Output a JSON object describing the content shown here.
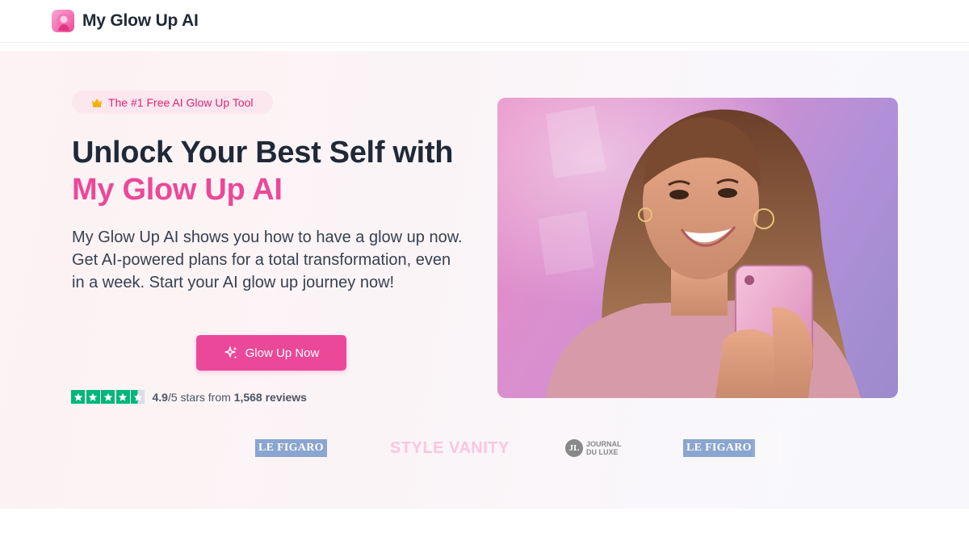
{
  "nav": {
    "brand": "My Glow Up AI",
    "logo_icon": "woman-silhouette-icon"
  },
  "hero": {
    "badge": {
      "icon": "crown-icon",
      "label": "The #1 Free AI Glow Up Tool"
    },
    "headline_line1": "Unlock Your Best Self with",
    "headline_accent": "My Glow Up AI",
    "lead": "My Glow Up AI shows you how to have a glow up now. Get AI-powered plans for a total transformation, even in a week. Start your AI glow up journey now!",
    "cta": {
      "label": "Glow Up Now",
      "icon": "sparkles-icon"
    },
    "rating": {
      "score": "4.9",
      "out_of": "/5 stars from ",
      "reviews": "1,568 reviews",
      "stars": 4.5
    },
    "image_icon": "woman-with-phone-photo"
  },
  "press": {
    "logos": [
      "LE FIGARO",
      "STYLE VANITY",
      "JOURNAL DU LUXE",
      "LE FIGARO"
    ]
  },
  "colors": {
    "accent": "#ec4899",
    "accent_soft": "#fce7ef",
    "text_dark": "#1f2937",
    "trustpilot_green": "#00b67a"
  }
}
